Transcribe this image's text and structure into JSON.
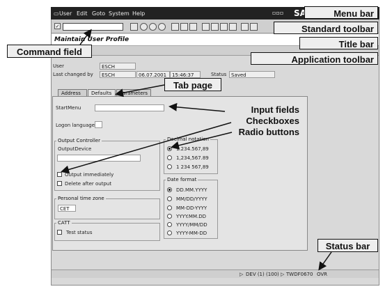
{
  "menu": [
    "User",
    "Edit",
    "Goto",
    "System",
    "Help"
  ],
  "brand": "SA",
  "title": "Maintain User Profile",
  "header": {
    "user_label": "User",
    "user_value": "ESCH",
    "changed_label": "Last changed by",
    "changed_value": "ESCH",
    "date_value": "06.07.2001",
    "time_value": "15:46:37",
    "status_label": "Status",
    "status_value": "Saved"
  },
  "tabs": [
    "Address",
    "Defaults",
    "Parameters"
  ],
  "form": {
    "startmenu_label": "StartMenu",
    "logon_label": "Logon language",
    "output_group": "Output Controller",
    "output_device_label": "OutputDevice",
    "output_immediately": "Output immediately",
    "delete_after": "Delete after output",
    "tz_group": "Personal time zone",
    "tz_value": "CET",
    "catt_group": "CATT",
    "test_status": "Test status",
    "decimal_group": "Decimal notation",
    "decimal_options": [
      "1.234.567,89",
      "1,234,567.89",
      "1 234 567,89"
    ],
    "date_group": "Date format",
    "date_options": [
      "DD.MM.YYYY",
      "MM/DD/YYYY",
      "MM-DD-YYYY",
      "YYYY.MM.DD",
      "YYYY/MM/DD",
      "YYYY-MM-DD"
    ]
  },
  "status": {
    "system": "DEV (1) (100)",
    "server": "TWDF0670",
    "mode": "OVR"
  },
  "callouts": {
    "menu_bar": "Menu bar",
    "standard_toolbar": "Standard toolbar",
    "title_bar": "Title bar",
    "application_toolbar": "Application toolbar",
    "command_field": "Command field",
    "tab_page": "Tab page",
    "input_fields": "Input fields",
    "checkboxes": "Checkboxes",
    "radio_buttons": "Radio buttons",
    "status_bar": "Status bar"
  }
}
